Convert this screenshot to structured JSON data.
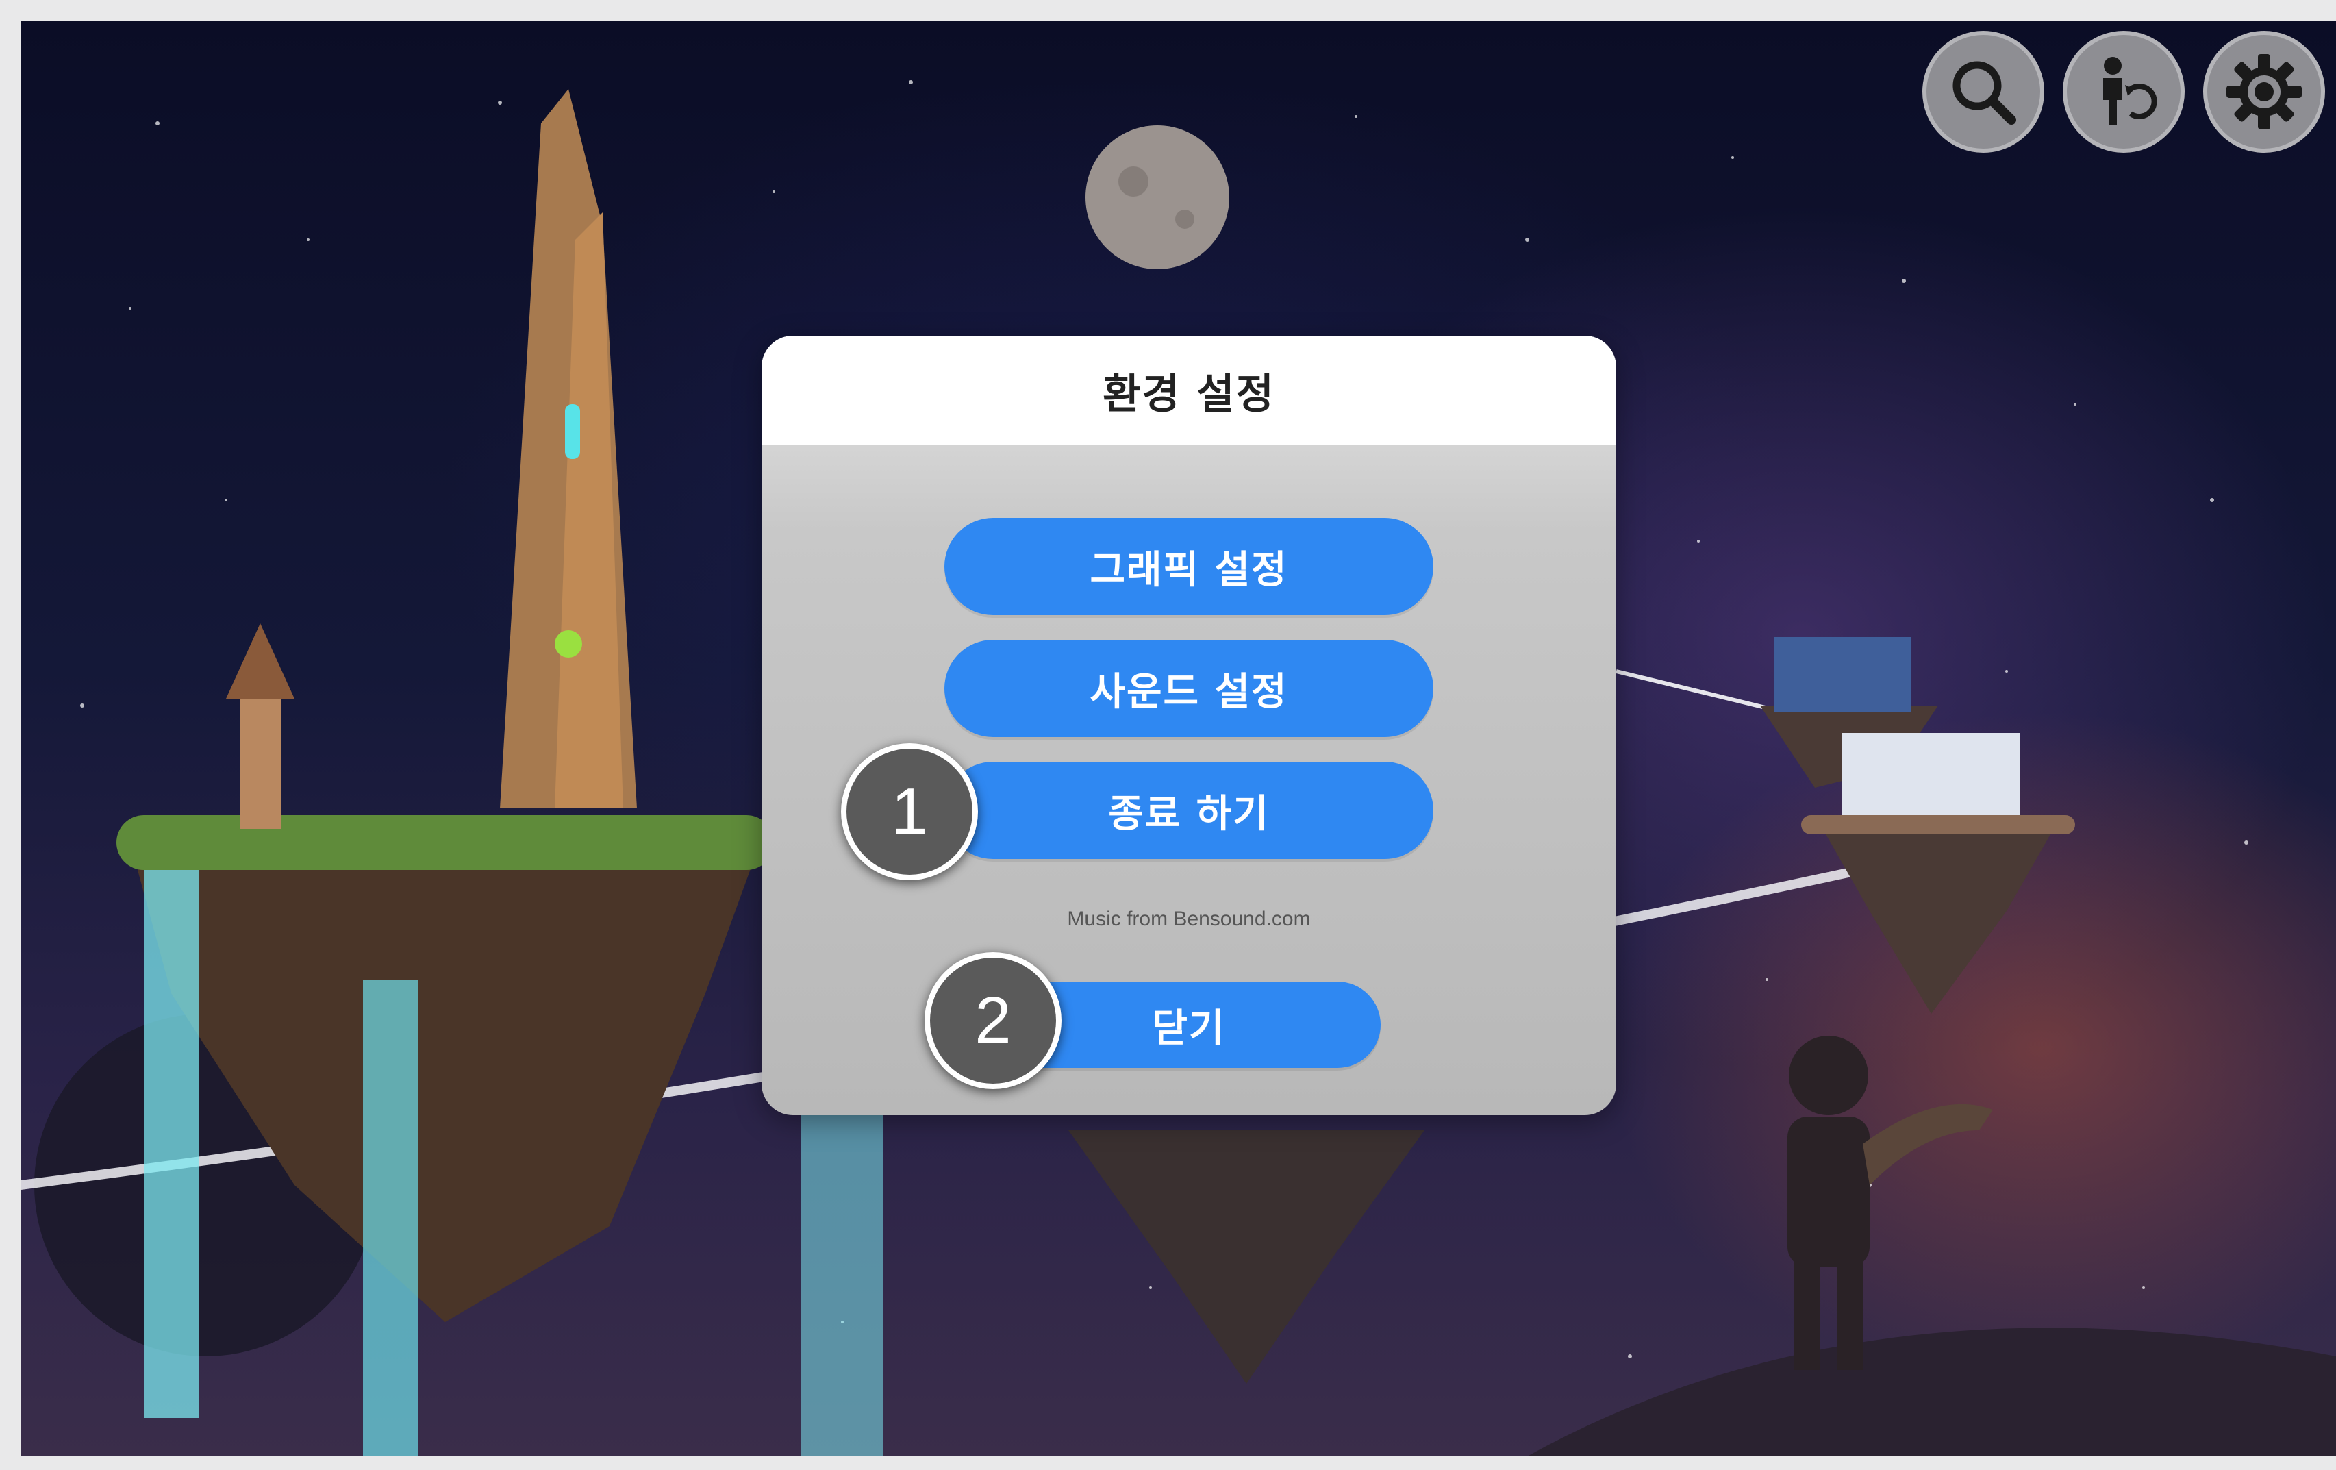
{
  "toolbar": {
    "items": [
      {
        "icon": "search-icon"
      },
      {
        "icon": "character-switch-icon"
      },
      {
        "icon": "gear-icon"
      }
    ]
  },
  "dialog": {
    "title": "환경 설정",
    "buttons": {
      "graphics": "그래픽 설정",
      "sound": "사운드 설정",
      "quit": "종료 하기",
      "close": "닫기"
    },
    "credit": "Music from Bensound.com"
  },
  "markers": [
    "1",
    "2"
  ],
  "colors": {
    "button": "#2f88f2",
    "header": "#ffffff",
    "dialog": "#c4c4c4",
    "marker": "#5a5a5a"
  }
}
